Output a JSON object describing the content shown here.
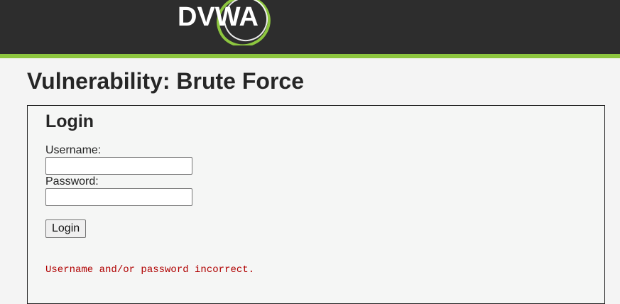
{
  "header": {
    "logo_text": "DVWA",
    "accent_color": "#8dc63f",
    "background_color": "#2d2d2d"
  },
  "page": {
    "title": "Vulnerability: Brute Force"
  },
  "login_form": {
    "title": "Login",
    "username_label": "Username:",
    "username_value": "",
    "password_label": "Password:",
    "password_value": "",
    "submit_label": "Login",
    "error_message": "Username and/or password incorrect.",
    "error_color": "#b00000"
  }
}
